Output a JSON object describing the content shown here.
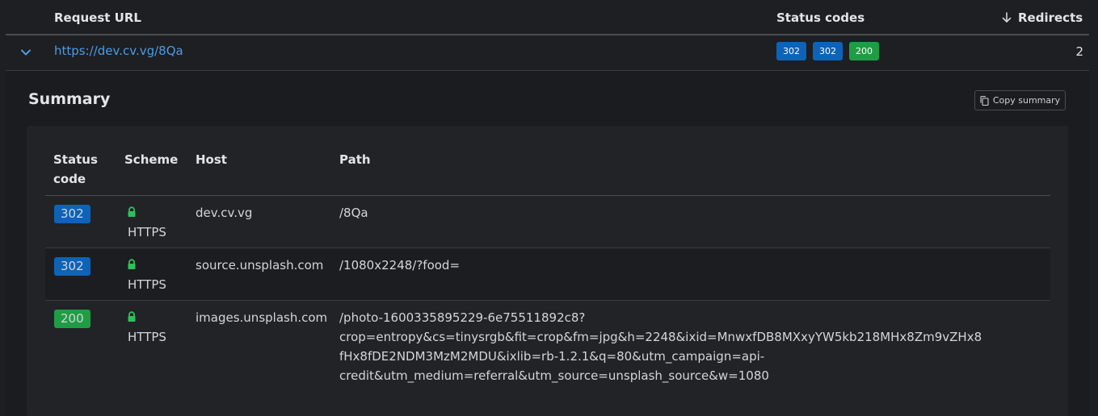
{
  "header": {
    "request_url": "Request URL",
    "status_codes": "Status codes",
    "redirects": "Redirects",
    "sort_icon": "arrow-down-icon"
  },
  "request": {
    "url": "https://dev.cv.vg/8Qa",
    "codes": [
      "302",
      "302",
      "200"
    ],
    "redirect_count": "2"
  },
  "summary": {
    "title": "Summary",
    "copy_label": "Copy summary",
    "columns": {
      "status_line1": "Status",
      "status_line2": "code",
      "scheme": "Scheme",
      "host": "Host",
      "path": "Path"
    },
    "rows": [
      {
        "code": "302",
        "scheme": "HTTPS",
        "host": "dev.cv.vg",
        "path": "/8Qa"
      },
      {
        "code": "302",
        "scheme": "HTTPS",
        "host": "source.unsplash.com",
        "path": "/1080x2248/?food="
      },
      {
        "code": "200",
        "scheme": "HTTPS",
        "host": "images.unsplash.com",
        "path_lines": [
          "/photo-1600335895229-6e75511892c8?",
          "crop=entropy&cs=tinysrgb&fit=crop&fm=jpg&h=2248&ixid=MnwxfDB8MXxyYW5kb218MHx8Zm9vZHx8",
          "fHx8fDE2NDM3MzM2MDU&ixlib=rb-1.2.1&q=80&utm_campaign=api-",
          "credit&utm_medium=referral&utm_source=unsplash_source&w=1080"
        ]
      }
    ]
  },
  "colors": {
    "badge_302": "#0d63b8",
    "badge_200": "#1f9d45",
    "link": "#4a9be8",
    "lock": "#2fbf5a"
  }
}
